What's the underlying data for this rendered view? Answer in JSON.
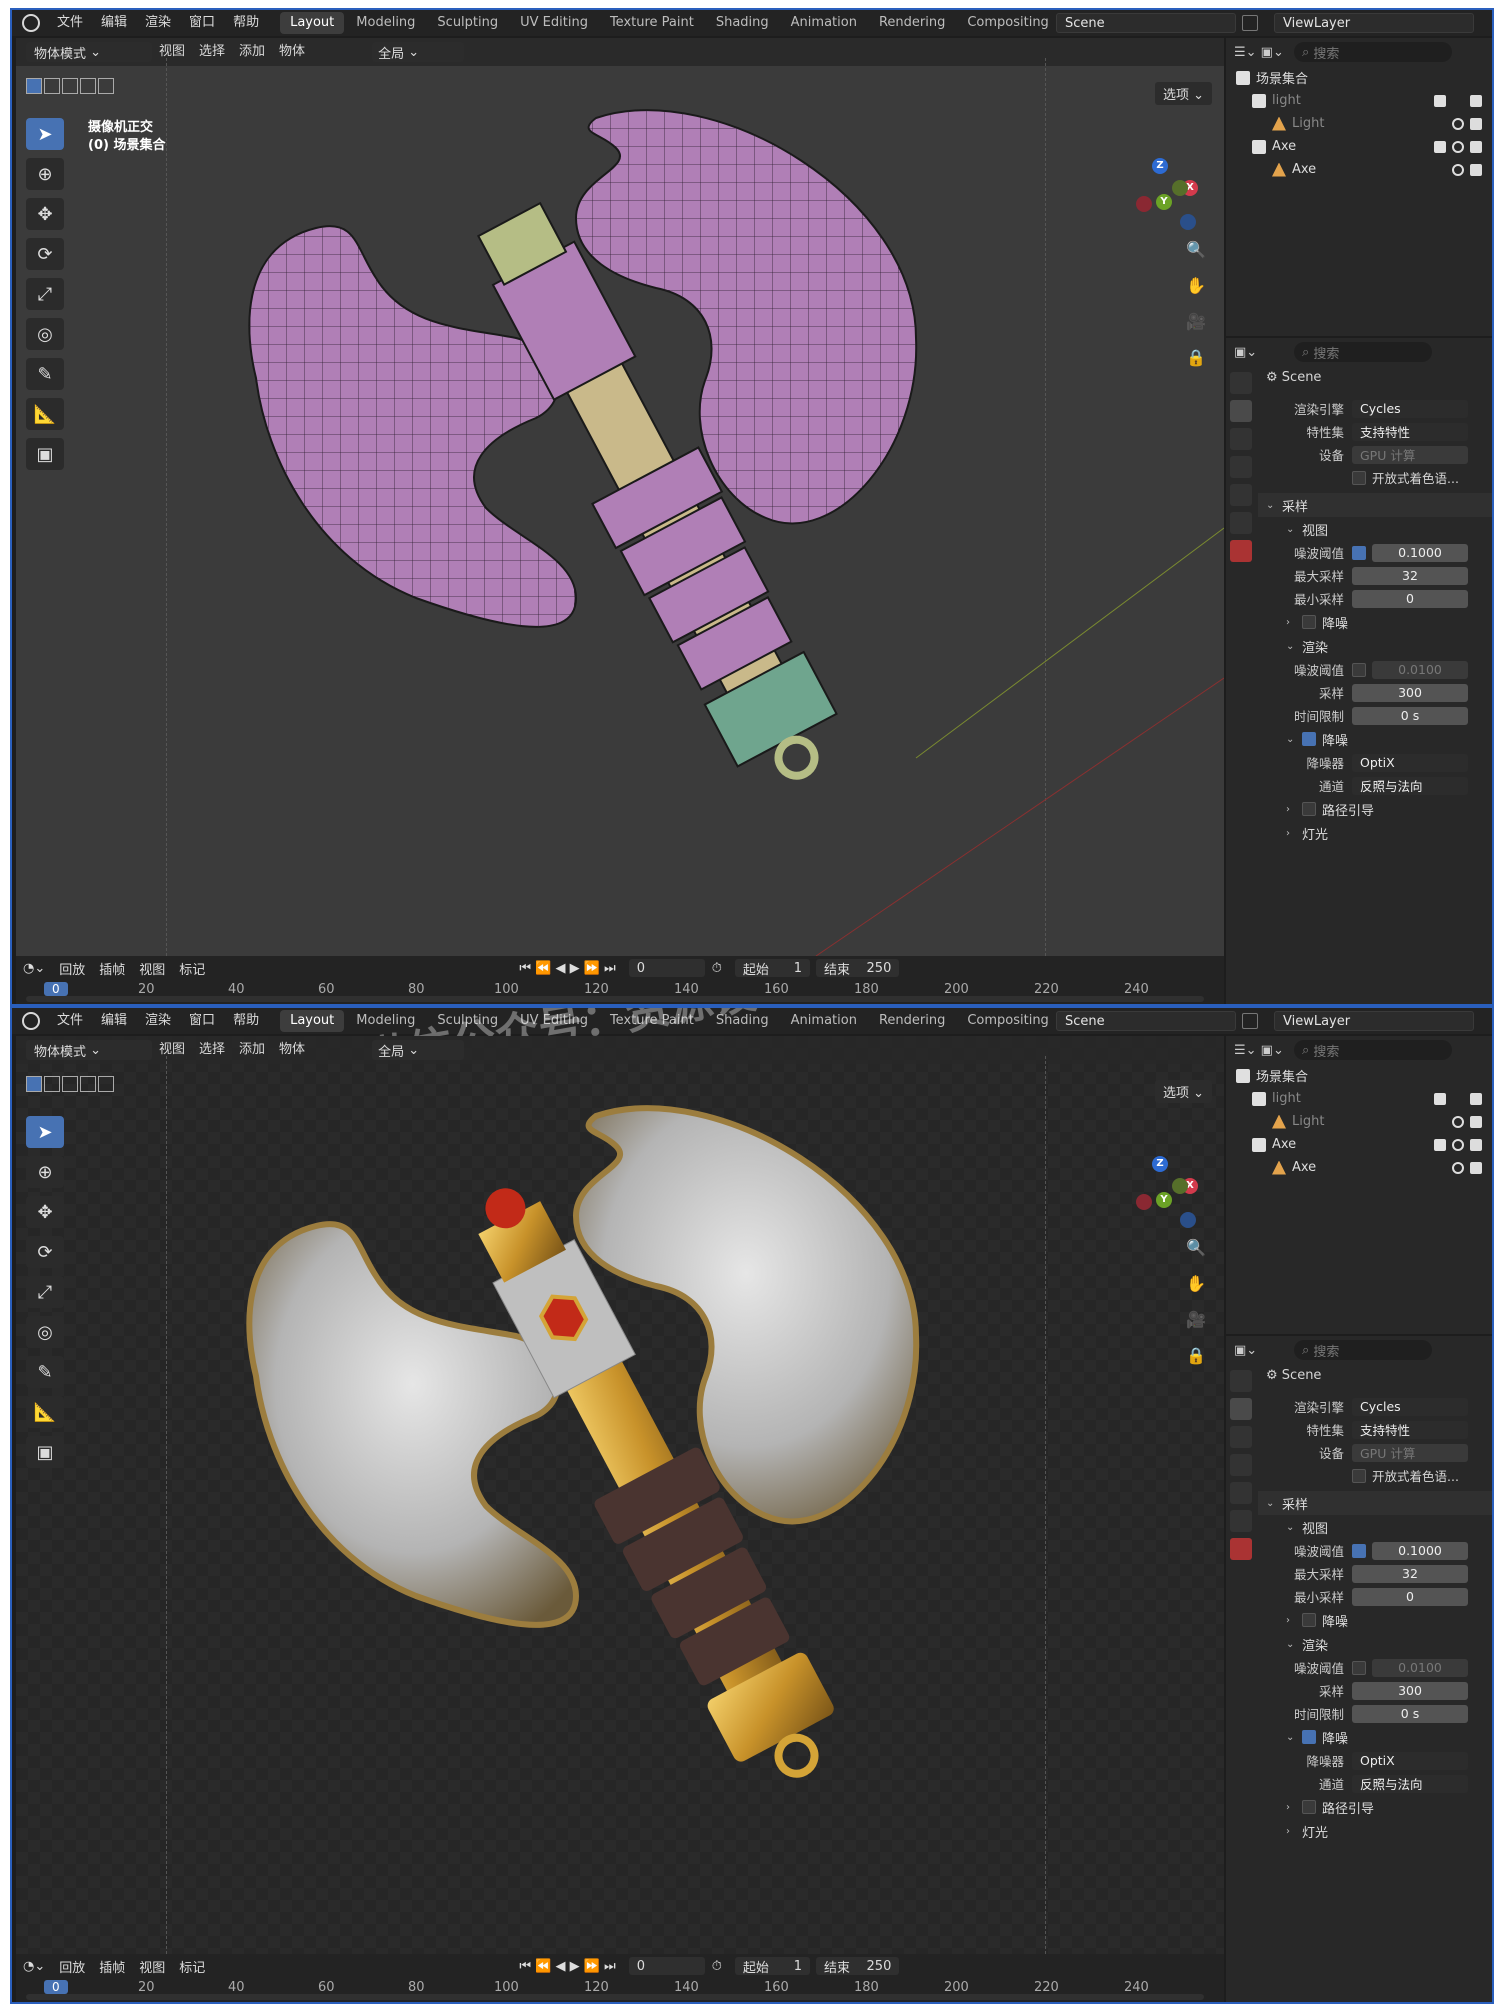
{
  "topbar": {
    "menus": [
      "文件",
      "编辑",
      "渲染",
      "窗口",
      "帮助"
    ],
    "workspaces": [
      "Layout",
      "Modeling",
      "Sculpting",
      "UV Editing",
      "Texture Paint",
      "Shading",
      "Animation",
      "Rendering",
      "Compositing"
    ],
    "active_workspace": "Layout",
    "scene": "Scene",
    "view_layer": "ViewLayer"
  },
  "viewport": {
    "mode": "物体模式",
    "menus": [
      "视图",
      "选择",
      "添加",
      "物体"
    ],
    "orientation": "全局",
    "options": "选项",
    "overlay_line1": "摄像机正交",
    "overlay_line2": "(0) 场景集合"
  },
  "timeline": {
    "menus": [
      "回放",
      "插帧",
      "视图",
      "标记"
    ],
    "current_frame": "0",
    "start_label": "起始",
    "start": "1",
    "end_label": "结束",
    "end": "250",
    "ruler": [
      "0",
      "20",
      "40",
      "60",
      "80",
      "100",
      "120",
      "140",
      "160",
      "180",
      "200",
      "220",
      "240"
    ]
  },
  "outliner": {
    "search_placeholder": "搜索",
    "root": "场景集合",
    "rows": [
      {
        "label": "light",
        "type": "collection",
        "depth": 1
      },
      {
        "label": "Light",
        "type": "light",
        "depth": 2
      },
      {
        "label": "Axe",
        "type": "collection",
        "depth": 1
      },
      {
        "label": "Axe",
        "type": "object",
        "depth": 2
      }
    ]
  },
  "properties": {
    "search_placeholder": "搜索",
    "context": "Scene",
    "render_engine_label": "渲染引擎",
    "render_engine": "Cycles",
    "feature_set_label": "特性集",
    "feature_set": "支持特性",
    "device_label": "设备",
    "device": "GPU 计算",
    "osl_label": "开放式着色语...",
    "sampling_label": "采样",
    "viewport_label": "视图",
    "noise_threshold_label": "噪波阈值",
    "viewport_noise_threshold": "0.1000",
    "max_samples_label": "最大采样",
    "max_samples": "32",
    "min_samples_label": "最小采样",
    "min_samples": "0",
    "denoise_label": "降噪",
    "render_label": "渲染",
    "render_noise_threshold": "0.0100",
    "samples_label": "采样",
    "samples": "300",
    "time_limit_label": "时间限制",
    "time_limit": "0 s",
    "denoiser_label": "降噪器",
    "denoiser": "OptiX",
    "passes_label": "通道",
    "passes": "反照与法向",
    "path_guiding_label": "路径引导",
    "lights_label": "灯光"
  },
  "watermark": "微信公众号：资源设",
  "colors": {
    "accent": "#4772b3",
    "axe_blade_wire": "#b07fb6",
    "axe_blade_render": "#c8c8c8",
    "gold": "#d4a437",
    "leather": "#4a3430",
    "gem": "#c22a18"
  }
}
